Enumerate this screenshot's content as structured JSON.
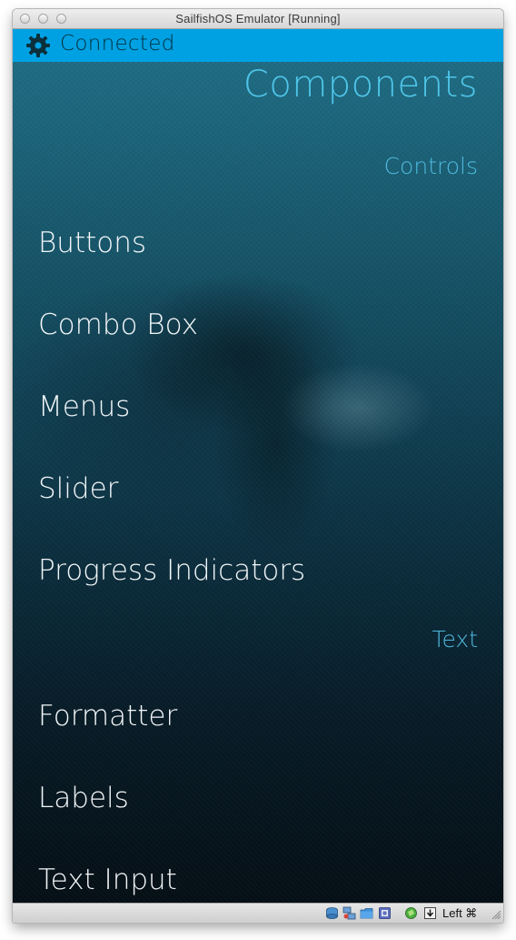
{
  "window": {
    "title": "SailfishOS Emulator [Running]"
  },
  "statusbar": {
    "status_text": "Connected",
    "icon": "gear-icon"
  },
  "page": {
    "title": "Components",
    "sections": [
      {
        "header": "Controls",
        "items": [
          "Buttons",
          "Combo Box",
          "Menus",
          "Slider",
          "Progress Indicators"
        ]
      },
      {
        "header": "Text",
        "items": [
          "Formatter",
          "Labels",
          "Text Input"
        ]
      }
    ]
  },
  "bottombar": {
    "icons": [
      "disk-icon",
      "network-icon",
      "folder-icon",
      "display-icon",
      "cpu-icon",
      "mouse-capture-icon"
    ],
    "host_key": "Left ⌘"
  },
  "colors": {
    "status_bar": "#00a1e2",
    "highlight": "#4fc6ea",
    "primary_text": "#f2f6f8"
  }
}
